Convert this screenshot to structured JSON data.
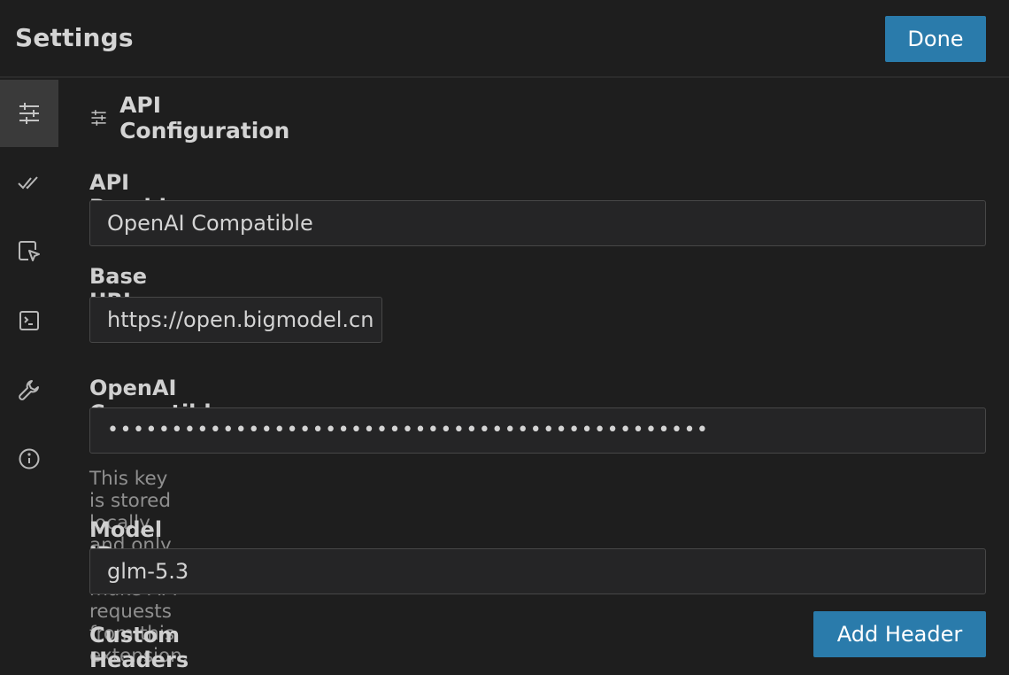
{
  "header": {
    "title": "Settings",
    "done_label": "Done"
  },
  "sidebar": {
    "tabs": [
      {
        "icon": "sliders-icon",
        "active": true
      },
      {
        "icon": "double-check-icon",
        "active": false
      },
      {
        "icon": "cursor-select-icon",
        "active": false
      },
      {
        "icon": "terminal-icon",
        "active": false
      },
      {
        "icon": "wrench-icon",
        "active": false
      },
      {
        "icon": "info-icon",
        "active": false
      }
    ]
  },
  "section": {
    "title": "API Configuration",
    "icon": "sliders-icon"
  },
  "form": {
    "provider_label": "API Provider",
    "provider_value": "OpenAI Compatible",
    "base_url_label": "Base URL",
    "base_url_value": "https://open.bigmodel.cn",
    "api_key_label": "OpenAI Compatible API Key",
    "api_key_value": "•••••••••••••••••••••••••••••••••••••••••••••••",
    "api_key_hint": "This key is stored locally and only used to make API requests from this extension.",
    "model_id_label": "Model ID",
    "model_id_value": "glm-5.3",
    "custom_headers_label": "Custom Headers",
    "add_header_label": "Add Header"
  },
  "colors": {
    "accent": "#2a7bab",
    "background": "#1e1e1e",
    "active_tab": "#3a3a3a"
  }
}
